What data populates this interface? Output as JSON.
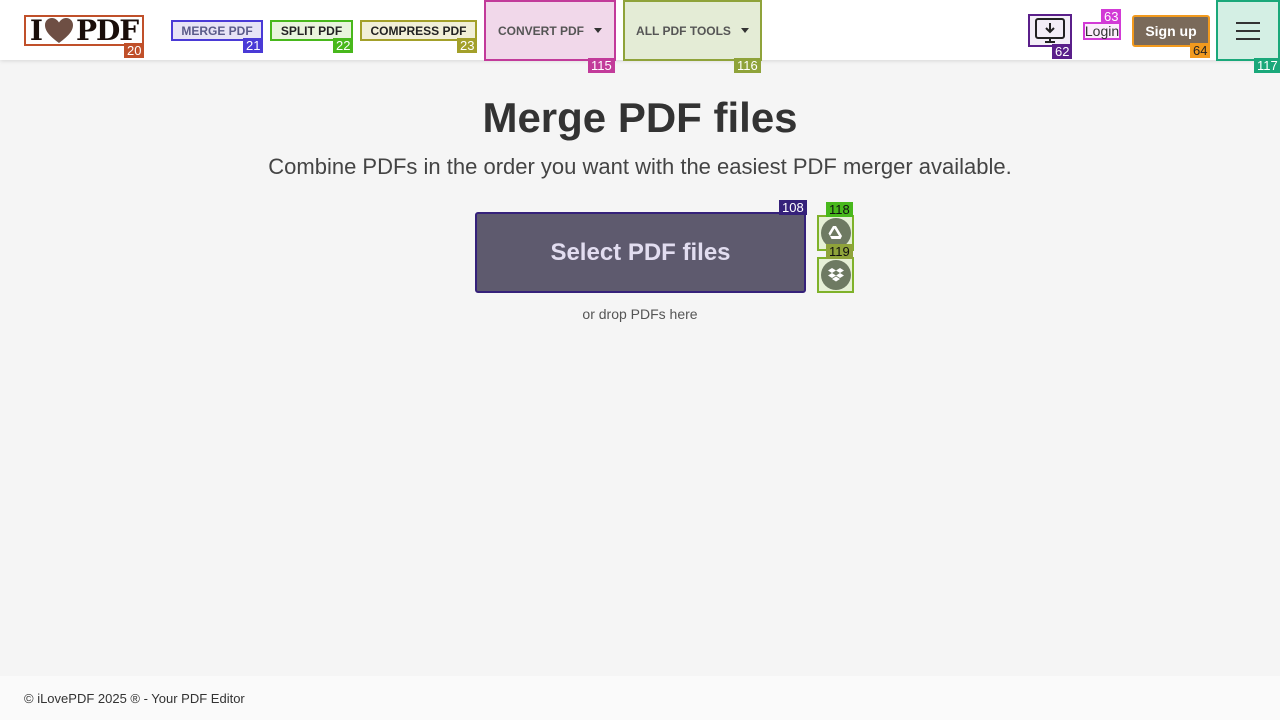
{
  "header": {
    "logo_text_left": "I",
    "logo_text_right": "PDF",
    "nav": {
      "merge": "MERGE PDF",
      "split": "SPLIT PDF",
      "compress": "COMPRESS PDF",
      "convert": "CONVERT PDF",
      "all_tools": "ALL PDF TOOLS"
    },
    "login": "Login",
    "signup": "Sign up"
  },
  "main": {
    "title": "Merge PDF files",
    "subtitle": "Combine PDFs in the order you want with the easiest PDF merger available.",
    "select_button": "Select PDF files",
    "drop_hint": "or drop PDFs here"
  },
  "footer": {
    "text": "© iLovePDF 2025 ® - Your PDF Editor"
  },
  "badges": {
    "logo": "20",
    "merge": "21",
    "split": "22",
    "compress": "23",
    "convert": "115",
    "all_tools": "116",
    "desktop": "62",
    "login": "63",
    "signup": "64",
    "menu": "117",
    "select": "108",
    "gdrive": "118",
    "dropbox": "119"
  },
  "icons": {
    "logo_heart": "heart-icon",
    "desktop": "desktop-download-icon",
    "menu": "hamburger-menu-icon",
    "gdrive": "google-drive-icon",
    "dropbox": "dropbox-icon",
    "caret": "caret-down-icon"
  },
  "colors": {
    "page_bg": "#f5f5f5",
    "select_button_bg": "#5e5a6e",
    "signup_bg": "#7a6a5a"
  }
}
